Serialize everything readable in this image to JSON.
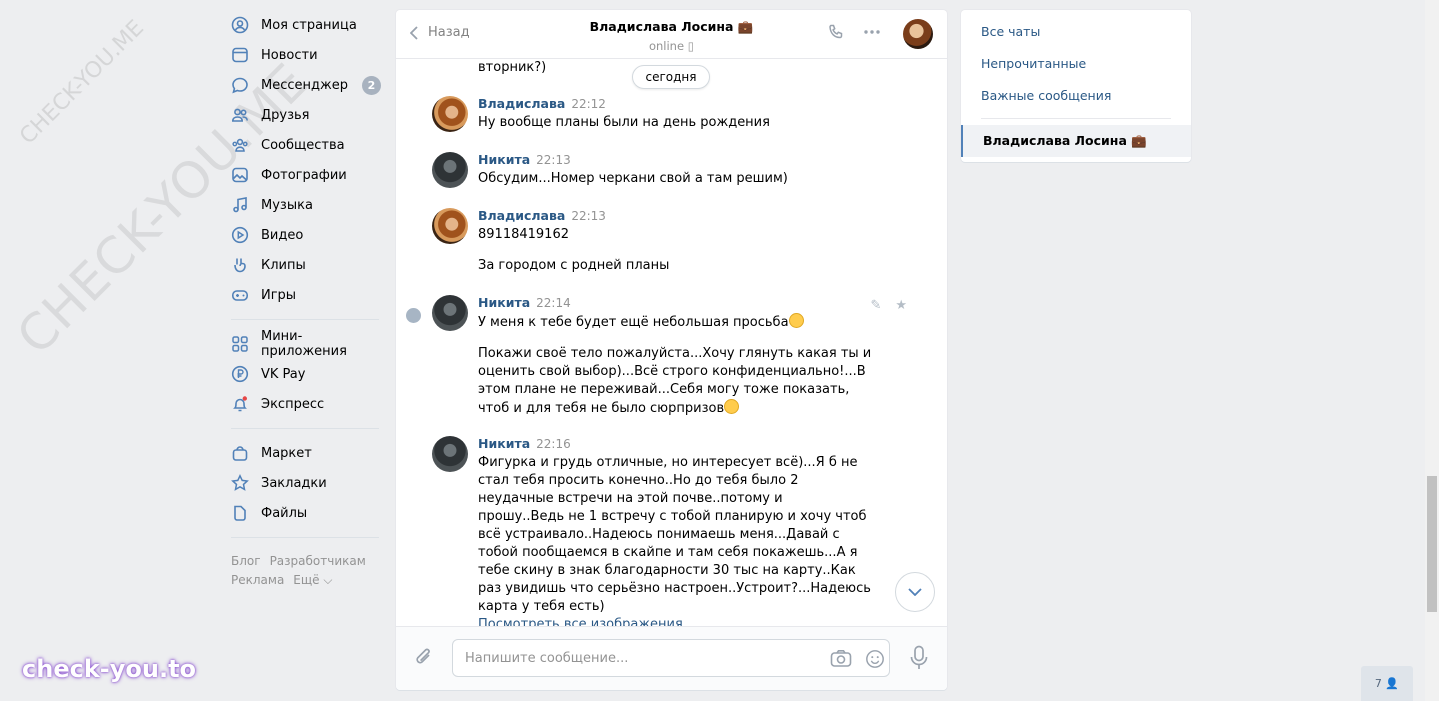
{
  "watermarks": {
    "diagonal_big": "CHECK-YOU.ME",
    "diagonal_small": "CHECK-YOU.ME",
    "brand": "check-you.to"
  },
  "nav": {
    "items": [
      {
        "label": "Моя страница",
        "icon": "user-circle-icon"
      },
      {
        "label": "Новости",
        "icon": "news-icon"
      },
      {
        "label": "Мессенджер",
        "icon": "message-icon",
        "badge": "2"
      },
      {
        "label": "Друзья",
        "icon": "friends-icon"
      },
      {
        "label": "Сообщества",
        "icon": "communities-icon"
      },
      {
        "label": "Фотографии",
        "icon": "photo-icon"
      },
      {
        "label": "Музыка",
        "icon": "music-icon"
      },
      {
        "label": "Видео",
        "icon": "video-icon"
      },
      {
        "label": "Клипы",
        "icon": "clips-icon"
      },
      {
        "label": "Игры",
        "icon": "games-icon"
      }
    ],
    "items2": [
      {
        "label": "Мини-приложения",
        "icon": "apps-icon"
      },
      {
        "label": "VK Pay",
        "icon": "ruble-icon"
      },
      {
        "label": "Экспресс",
        "icon": "bell-icon"
      }
    ],
    "items3": [
      {
        "label": "Маркет",
        "icon": "bag-icon"
      },
      {
        "label": "Закладки",
        "icon": "star-icon"
      },
      {
        "label": "Файлы",
        "icon": "file-icon"
      }
    ],
    "footer": {
      "blog": "Блог",
      "dev": "Разработчикам",
      "ads": "Реклама",
      "more": "Ещё ⌵"
    }
  },
  "chat": {
    "back_label": "Назад",
    "peer_name": "Владислава Лосина 💼",
    "peer_status": "online",
    "top_partial_text": "вторник?)",
    "day_pill": "сегодня",
    "messages": [
      {
        "author": "Владислава",
        "time": "22:12",
        "texts": [
          "Ну вообще планы были на день рождения"
        ]
      },
      {
        "author": "Никита",
        "time": "22:13",
        "texts": [
          "Обсудим...Номер черкани свой а там решим)"
        ]
      },
      {
        "author": "Владислава",
        "time": "22:13",
        "texts": [
          "89118419162",
          "За городом с родней планы"
        ]
      },
      {
        "author": "Никита",
        "time": "22:14",
        "texts": [
          "У меня к тебе будет ещё небольшая просьба",
          "Покажи своё тело пожалуйста...Хочу глянуть какая ты и оценить свой выбор)...Всё строго конфиденциально!...В этом плане не переживай...Себя могу тоже показать, чтоб и для тебя не было сюрпризов"
        ]
      },
      {
        "author": "Никита",
        "time": "22:16",
        "texts": [
          "Фигурка и грудь отличные, но интересует всё)...Я б не стал тебя просить конечно..Но до тебя было 2 неудачные встречи на этой почве..потому и прошу..Ведь не 1 встречу с тобой планирую и хочу чтоб всё устраивало..Надеюсь понимаешь меня...Давай с тобой пообщаемся в скайпе и там себя покажешь...А я тебе скину в знак благодарности 30 тыс на карту..Как раз увидишь что серьёзно настроен..Устроит?...Надеюсь карта у тебя есть)"
        ],
        "link": "Посмотреть все изображения"
      }
    ],
    "composer_placeholder": "Напишите сообщение..."
  },
  "right": {
    "all_chats": "Все чаты",
    "unread": "Непрочитанные",
    "important": "Важные сообщения",
    "active_chat": "Владислава Лосина 💼"
  },
  "online_widget": "7"
}
